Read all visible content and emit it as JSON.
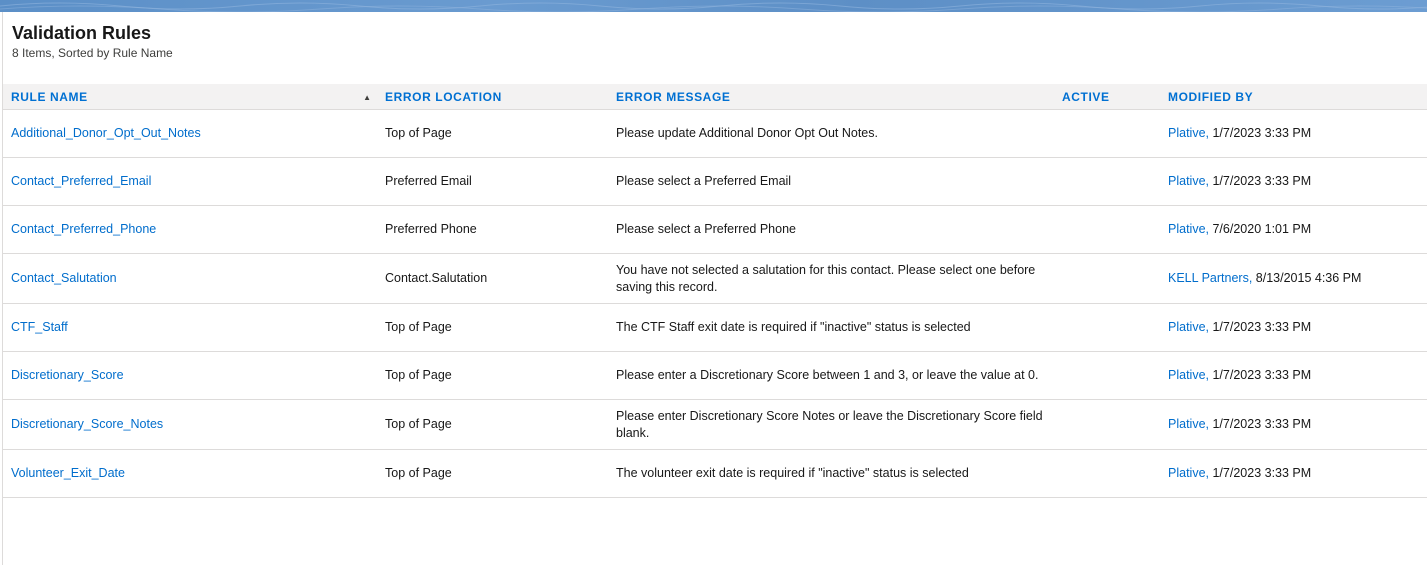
{
  "header": {
    "title": "Validation Rules",
    "subtitle": "8 Items, Sorted by Rule Name"
  },
  "columns": {
    "rule_name": "RULE NAME",
    "error_location": "ERROR LOCATION",
    "error_message": "ERROR MESSAGE",
    "active": "ACTIVE",
    "modified_by": "MODIFIED BY"
  },
  "sort": {
    "icon": "sort-ascending-icon",
    "glyph": "▲"
  },
  "rows": [
    {
      "rule_name": "Additional_Donor_Opt_Out_Notes",
      "error_location": "Top of Page",
      "error_message": "Please update Additional Donor Opt Out Notes.",
      "active": "",
      "modified_by_name": "Plative,",
      "modified_date": "1/7/2023 3:33 PM"
    },
    {
      "rule_name": "Contact_Preferred_Email",
      "error_location": "Preferred Email",
      "error_message": "Please select a Preferred Email",
      "active": "",
      "modified_by_name": "Plative,",
      "modified_date": "1/7/2023 3:33 PM"
    },
    {
      "rule_name": "Contact_Preferred_Phone",
      "error_location": "Preferred Phone",
      "error_message": "Please select a Preferred Phone",
      "active": "",
      "modified_by_name": "Plative,",
      "modified_date": "7/6/2020 1:01 PM"
    },
    {
      "rule_name": "Contact_Salutation",
      "error_location": "Contact.Salutation",
      "error_message": "You have not selected a salutation for this contact. Please select one before saving this record.",
      "active": "",
      "modified_by_name": "KELL Partners,",
      "modified_date": "8/13/2015 4:36 PM"
    },
    {
      "rule_name": "CTF_Staff",
      "error_location": "Top of Page",
      "error_message": "The CTF Staff exit date is required if \"inactive\" status is selected",
      "active": "",
      "modified_by_name": "Plative,",
      "modified_date": "1/7/2023 3:33 PM"
    },
    {
      "rule_name": "Discretionary_Score",
      "error_location": "Top of Page",
      "error_message": "Please enter a Discretionary Score between 1 and 3, or leave the value at 0.",
      "active": "",
      "modified_by_name": "Plative,",
      "modified_date": "1/7/2023 3:33 PM"
    },
    {
      "rule_name": "Discretionary_Score_Notes",
      "error_location": "Top of Page",
      "error_message": "Please enter Discretionary Score Notes or leave the Discretionary Score field blank.",
      "active": "",
      "modified_by_name": "Plative,",
      "modified_date": "1/7/2023 3:33 PM"
    },
    {
      "rule_name": "Volunteer_Exit_Date",
      "error_location": "Top of Page",
      "error_message": "The volunteer exit date is required if \"inactive\" status is selected",
      "active": "",
      "modified_by_name": "Plative,",
      "modified_date": "1/7/2023 3:33 PM"
    }
  ],
  "colors": {
    "link": "#006dcc",
    "header_text": "#0070d2",
    "header_bg": "#f3f2f2",
    "border": "#dddbda",
    "banner": "#5b8fc7"
  }
}
